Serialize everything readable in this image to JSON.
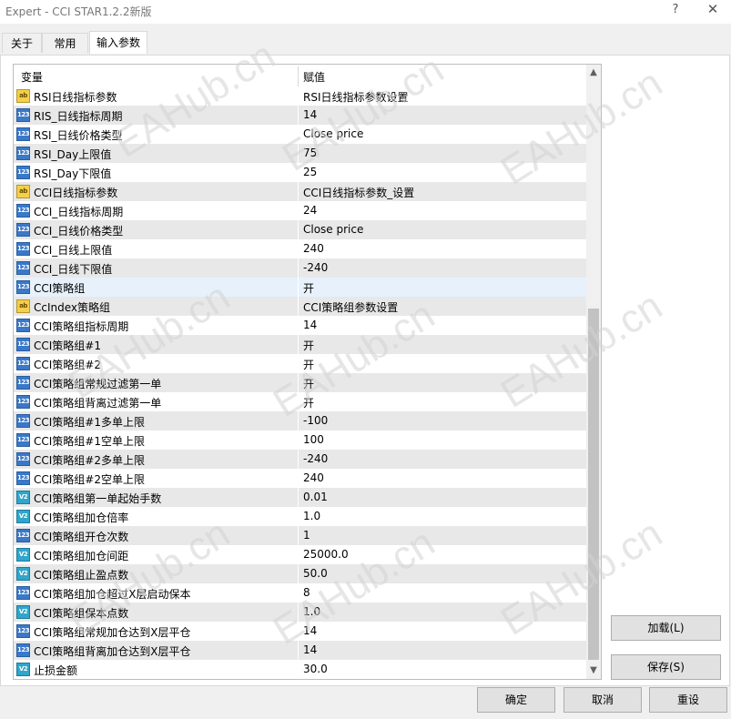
{
  "window": {
    "title": "Expert - CCI STAR1.2.2新版",
    "help_label": "?",
    "close_label": "✕"
  },
  "tabs": [
    {
      "label": "关于"
    },
    {
      "label": "常用"
    },
    {
      "label": "输入参数"
    }
  ],
  "table": {
    "col_variable": "变量",
    "col_value": "赋值",
    "rows": [
      {
        "icon": "ab",
        "name": "RSI日线指标参数",
        "value": "RSI日线指标参数设置"
      },
      {
        "icon": "123",
        "name": "RIS_日线指标周期",
        "value": "14"
      },
      {
        "icon": "123",
        "name": "RSI_日线价格类型",
        "value": "Close price"
      },
      {
        "icon": "123",
        "name": "RSI_Day上限值",
        "value": "75"
      },
      {
        "icon": "123",
        "name": "RSI_Day下限值",
        "value": "25"
      },
      {
        "icon": "ab",
        "name": "CCI日线指标参数",
        "value": "CCI日线指标参数_设置"
      },
      {
        "icon": "123",
        "name": "CCI_日线指标周期",
        "value": "24"
      },
      {
        "icon": "123",
        "name": "CCI_日线价格类型",
        "value": "Close price"
      },
      {
        "icon": "123",
        "name": "CCI_日线上限值",
        "value": "240"
      },
      {
        "icon": "123",
        "name": "CCI_日线下限值",
        "value": "-240"
      },
      {
        "icon": "123",
        "name": "CCI策略组",
        "value": "开"
      },
      {
        "icon": "ab",
        "name": "CcIndex策略组",
        "value": "CCI策略组参数设置"
      },
      {
        "icon": "123",
        "name": "CCI策略组指标周期",
        "value": "14"
      },
      {
        "icon": "123",
        "name": "CCI策略组#1",
        "value": "开"
      },
      {
        "icon": "123",
        "name": "CCI策略组#2",
        "value": "开"
      },
      {
        "icon": "123",
        "name": "CCI策略组常规过滤第一单",
        "value": "开"
      },
      {
        "icon": "123",
        "name": "CCI策略组背离过滤第一单",
        "value": "开"
      },
      {
        "icon": "123",
        "name": "CCI策略组#1多单上限",
        "value": "-100"
      },
      {
        "icon": "123",
        "name": "CCI策略组#1空单上限",
        "value": "100"
      },
      {
        "icon": "123",
        "name": "CCI策略组#2多单上限",
        "value": "-240"
      },
      {
        "icon": "123",
        "name": "CCI策略组#2空单上限",
        "value": "240"
      },
      {
        "icon": "v2",
        "name": "CCI策略组第一单起始手数",
        "value": "0.01"
      },
      {
        "icon": "v2",
        "name": "CCI策略组加仓倍率",
        "value": "1.0"
      },
      {
        "icon": "123",
        "name": "CCI策略组开仓次数",
        "value": "1"
      },
      {
        "icon": "v2",
        "name": "CCI策略组加仓间距",
        "value": "25000.0"
      },
      {
        "icon": "v2",
        "name": "CCI策略组止盈点数",
        "value": "50.0"
      },
      {
        "icon": "123",
        "name": "CCI策略组加仓超过X层启动保本",
        "value": "8"
      },
      {
        "icon": "v2",
        "name": "CCI策略组保本点数",
        "value": "1.0"
      },
      {
        "icon": "123",
        "name": "CCI策略组常规加仓达到X层平仓",
        "value": "14"
      },
      {
        "icon": "123",
        "name": "CCI策略组背离加仓达到X层平仓",
        "value": "14"
      },
      {
        "icon": "v2",
        "name": "止损金额",
        "value": "30.0"
      }
    ],
    "selected_row": 10
  },
  "icons": {
    "ab": "string-param-icon",
    "123": "integer-param-icon",
    "v2": "double-param-icon",
    "ab_text": "ab",
    "123_text": "123",
    "v2_text": "V2"
  },
  "buttons": {
    "load": "加载(L)",
    "save": "保存(S)",
    "ok": "确定",
    "cancel": "取消",
    "reset": "重设"
  },
  "watermark": "EAHub.cn",
  "colors": {
    "selected_row": "#e7f1fb",
    "alt_row": "#e8e8e8",
    "int_icon": "#3a78c8",
    "string_icon": "#f2d04a",
    "double_icon": "#2fa6cc"
  }
}
